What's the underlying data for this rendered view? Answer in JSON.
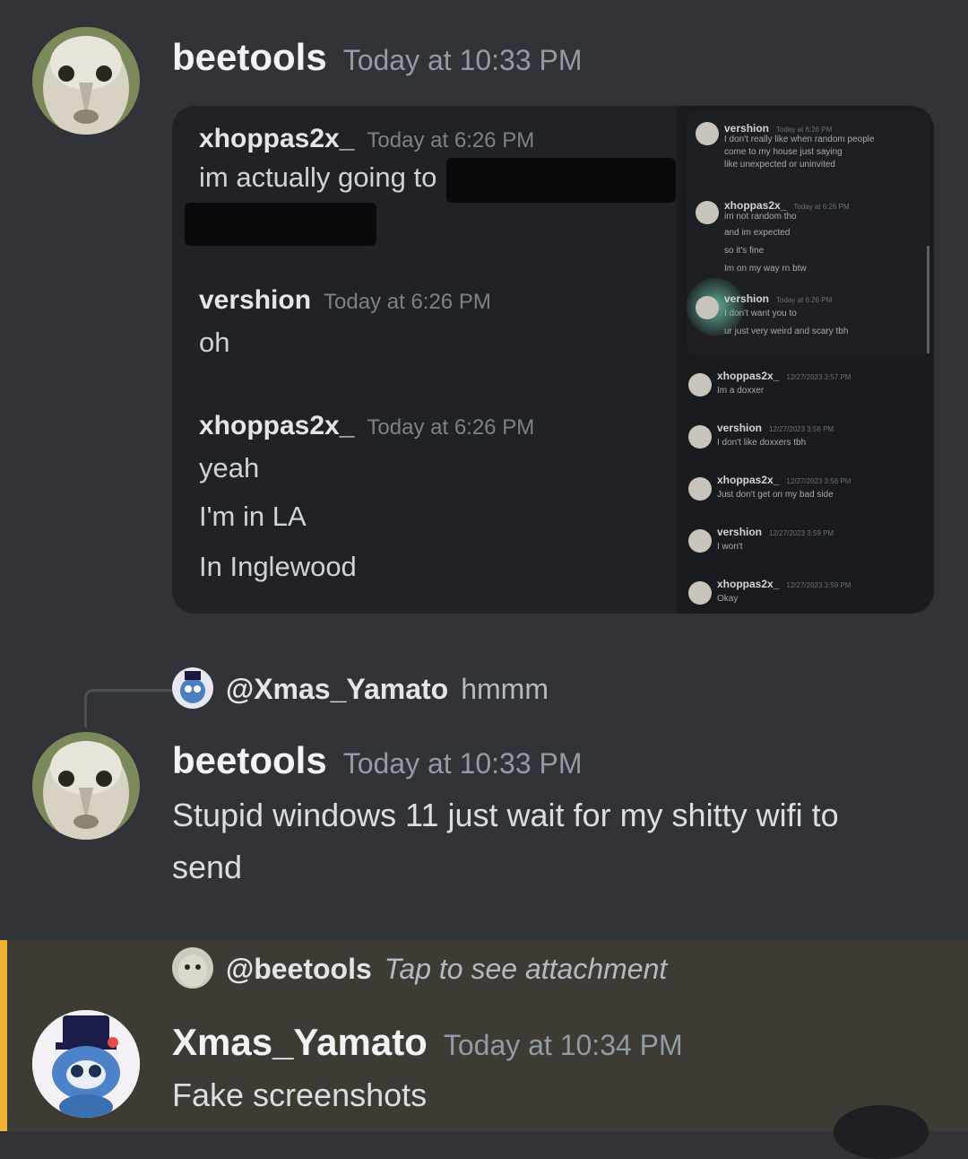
{
  "messages": [
    {
      "author": "beetools",
      "timestamp": "Today at 10:33 PM",
      "attachment": {
        "left_panel": [
          {
            "author": "xhoppas2x_",
            "timestamp": "Today at 6:26 PM",
            "lines": [
              "im actually going to"
            ]
          },
          {
            "author": "vershion",
            "timestamp": "Today at 6:26 PM",
            "lines": [
              "oh"
            ]
          },
          {
            "author": "xhoppas2x_",
            "timestamp": "Today at 6:26 PM",
            "lines": [
              "yeah",
              "I'm in LA",
              "In Inglewood"
            ]
          }
        ],
        "right_top": [
          {
            "author": "vershion",
            "timestamp": "Today at 6:26 PM",
            "lines": [
              "I don't really like when random people",
              "come to my house just saying",
              "like unexpected or uninvited"
            ]
          },
          {
            "author": "xhoppas2x_",
            "timestamp": "Today at 6:26 PM",
            "lines": [
              "im not random tho",
              "and im expected",
              "so it's fine",
              "Im on my way rn btw"
            ]
          },
          {
            "author": "vershion",
            "timestamp": "Today at 6:26 PM",
            "lines": [
              "I don't want you to",
              "ur just very weird and scary tbh"
            ]
          }
        ],
        "right_bottom": [
          {
            "author": "xhoppas2x_",
            "timestamp": "12/27/2023 3:57 PM",
            "lines": [
              "Im a doxxer"
            ]
          },
          {
            "author": "vershion",
            "timestamp": "12/27/2023 3:58 PM",
            "lines": [
              "I don't like doxxers tbh"
            ]
          },
          {
            "author": "xhoppas2x_",
            "timestamp": "12/27/2023 3:58 PM",
            "lines": [
              "Just don't get on my bad side"
            ]
          },
          {
            "author": "vershion",
            "timestamp": "12/27/2023 3:59 PM",
            "lines": [
              "I won't"
            ]
          },
          {
            "author": "xhoppas2x_",
            "timestamp": "12/27/2023 3:59 PM",
            "lines": [
              "Okay"
            ]
          }
        ]
      }
    },
    {
      "reply_to": {
        "mention": "@Xmas_Yamato",
        "text": "hmmm"
      },
      "author": "beetools",
      "timestamp": "Today at 10:33 PM",
      "text_line1": "Stupid windows 11 just wait for my shitty wifi to",
      "text_line2": "send"
    },
    {
      "reply_to": {
        "mention": "@beetools",
        "text": "Tap to see attachment"
      },
      "author": "Xmas_Yamato",
      "timestamp": "Today at 10:34 PM",
      "text": "Fake screenshots"
    }
  ],
  "colors": {
    "background": "#313338",
    "highlight": "#3d3b34",
    "highlight_bar": "#f0b232"
  }
}
